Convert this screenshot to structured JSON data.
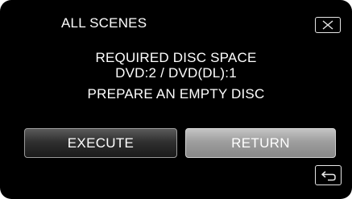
{
  "header": {
    "title": "ALL SCENES",
    "close_icon": "close-x-icon"
  },
  "message": {
    "line1": "REQUIRED DISC SPACE",
    "line2": "DVD:2 / DVD(DL):1",
    "line3": "PREPARE AN EMPTY DISC"
  },
  "buttons": {
    "execute_label": "EXECUTE",
    "return_label": "RETURN",
    "selected": "RETURN"
  },
  "footer": {
    "back_icon": "return-arrow-icon"
  },
  "colors": {
    "background": "#000000",
    "text": "#ffffff",
    "selected_button": "#a0a0a0",
    "unselected_button": "#2a2a2a"
  }
}
